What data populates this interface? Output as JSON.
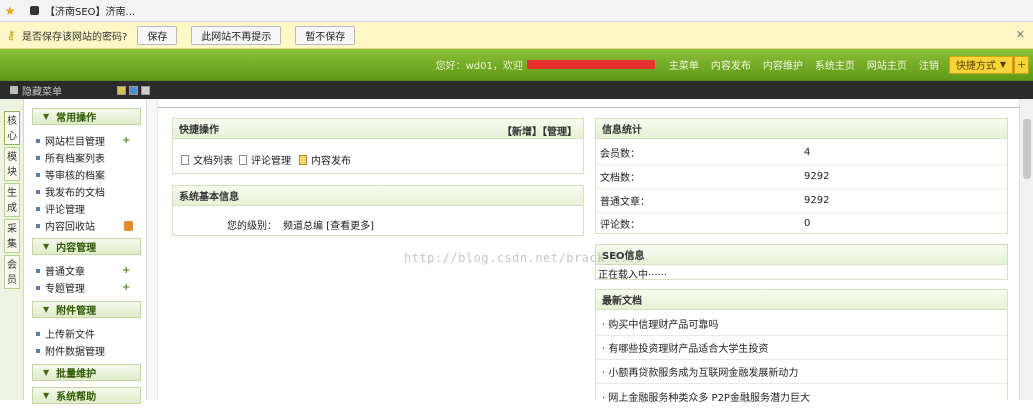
{
  "browser": {
    "tab_title": "【济南SEO】济南..."
  },
  "password_bar": {
    "message": "是否保存该网站的密码?",
    "buttons": [
      "保存",
      "此网站不再提示",
      "暂不保存"
    ]
  },
  "topnav": {
    "welcome": "您好：wd01，欢迎",
    "links": [
      "主菜单",
      "内容发布",
      "内容维护",
      "系统主页",
      "网站主页",
      "注销"
    ],
    "quick": "快捷方式",
    "plus": "+"
  },
  "darkbar": {
    "hide_menu": "隐藏菜单"
  },
  "vtabs": [
    {
      "label": "核\n心"
    },
    {
      "label": "模\n块"
    },
    {
      "label": "生\n成"
    },
    {
      "label": "采\n集"
    },
    {
      "label": "会\n员"
    }
  ],
  "leftmenu": {
    "groups": [
      {
        "title": "常用操作",
        "items": [
          {
            "label": "网站栏目管理",
            "action": "add"
          },
          {
            "label": "所有档案列表",
            "action": ""
          },
          {
            "label": "等审核的档案",
            "action": ""
          },
          {
            "label": "我发布的文档",
            "action": ""
          },
          {
            "label": "评论管理",
            "action": ""
          },
          {
            "label": "内容回收站",
            "action": "bin"
          }
        ]
      },
      {
        "title": "内容管理",
        "items": [
          {
            "label": "普通文章",
            "action": "add"
          },
          {
            "label": "专题管理",
            "action": "add"
          }
        ]
      },
      {
        "title": "附件管理",
        "items": [
          {
            "label": "上传新文件",
            "action": ""
          },
          {
            "label": "附件数据管理",
            "action": ""
          }
        ]
      },
      {
        "title": "批量维护",
        "items": []
      },
      {
        "title": "系统帮助",
        "items": []
      }
    ]
  },
  "quickops": {
    "title": "快捷操作",
    "actions": "【新增】【管理】",
    "links": [
      "文档列表",
      "评论管理",
      "内容发布"
    ]
  },
  "sysinfo": {
    "title": "系统基本信息",
    "level_label": "您的级别：",
    "level_value": "频道总编 [查看更多]"
  },
  "stats": {
    "title": "信息统计",
    "rows": [
      {
        "k": "会员数：",
        "v": "4"
      },
      {
        "k": "文档数：",
        "v": "9292"
      },
      {
        "k": "普通文章：",
        "v": "9292"
      },
      {
        "k": "评论数：",
        "v": "0"
      }
    ]
  },
  "seo": {
    "title": "SEO信息",
    "loading": "正在载入中······"
  },
  "latest": {
    "title": "最新文档",
    "items": [
      "· 购买中信理财产品可靠吗",
      "· 有哪些投资理财产品适合大学生投资",
      "· 小额再贷款服务成为互联网金融发展新动力",
      "· 网上金融服务种类众多 P2P金融服务潜力巨大"
    ]
  },
  "watermark": "http://blog.csdn.net/brack_l..."
}
